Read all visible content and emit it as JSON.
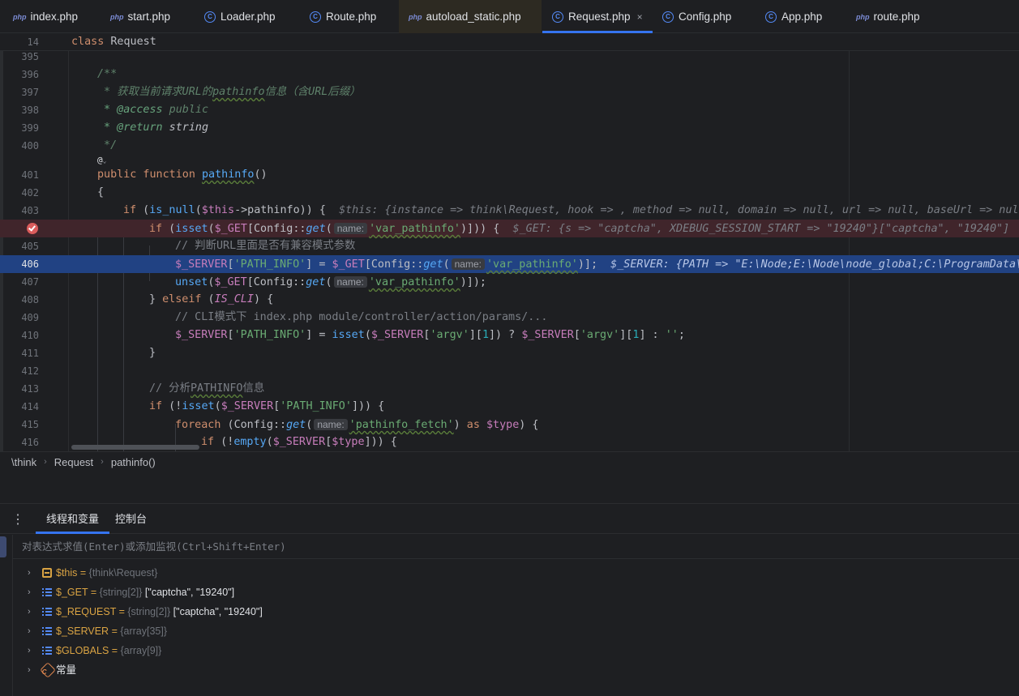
{
  "tabs": [
    {
      "label": "index.php",
      "icon": "php"
    },
    {
      "label": "start.php",
      "icon": "php"
    },
    {
      "label": "Loader.php",
      "icon": "class"
    },
    {
      "label": "Route.php",
      "icon": "class"
    },
    {
      "label": "autoload_static.php",
      "icon": "php"
    },
    {
      "label": "Request.php",
      "icon": "class"
    },
    {
      "label": "Config.php",
      "icon": "class"
    },
    {
      "label": "App.php",
      "icon": "class"
    },
    {
      "label": "route.php",
      "icon": "php"
    }
  ],
  "tab_close_glyph": "×",
  "icon_labels": {
    "php": "php",
    "class": "C"
  },
  "sticky": {
    "line": "14",
    "kw": "class",
    "name": "Request"
  },
  "lines": {
    "l395": "395",
    "l396": "396",
    "l397": "397",
    "l398": "398",
    "l399": "399",
    "l400": "400",
    "l401": "401",
    "l402": "402",
    "l403": "403",
    "l405": "405",
    "l406": "406",
    "l407": "407",
    "l408": "408",
    "l409": "409",
    "l410": "410",
    "l411": "411",
    "l412": "412",
    "l413": "413",
    "l414": "414",
    "l415": "415",
    "l416": "416"
  },
  "code": {
    "doc_open": "/**",
    "doc_desc_pre": " * 获取当前请求URL的",
    "doc_desc_word": "pathinfo",
    "doc_desc_post": "信息（含URL后缀）",
    "doc_access_tag": " * @access",
    "doc_access_val": " public",
    "doc_return_tag": " * @return",
    "doc_return_val": " string",
    "doc_close": " */",
    "annot_glyph": "@",
    "public": "public",
    "function": " function ",
    "fn_name": "pathinfo",
    "fn_parens": "()",
    "brace_open": "{",
    "brace_close": "}",
    "name_hint": "name:",
    "hint_key": "'var_pathinfo'",
    "if_kw": "if",
    "is_null": "is_null",
    "this_var": "$this",
    "arrow_prop": "->pathinfo)) {",
    "inline_this": "$this: {instance => think\\Request, hook => , method => null, domain => null, url => null, baseUrl => null",
    "isset": "isset",
    "get_var": "$_GET",
    "config": "Config",
    "get_fn": "get",
    "inline_get": "$_GET: {s => \"captcha\", XDEBUG_SESSION_START => \"19240\"}[\"captcha\", \"19240\"]",
    "cmt_405": "// 判断URL里面是否有兼容模式参数",
    "server_var": "$_SERVER",
    "path_info_key": "'PATH_INFO'",
    "inline_server": "$_SERVER: {PATH => \"E:\\Node;E:\\Node\\node_global;C:\\ProgramData\\",
    "unset": "unset",
    "elseif": "elseif",
    "is_cli": "IS_CLI",
    "cmt_409": "// CLI模式下 index.php module/controller/action/params/...",
    "argv_key": "'argv'",
    "one": "1",
    "empty_str": "''",
    "cmt_413_pre": "// 分析",
    "cmt_413_word": "PATHINFO",
    "cmt_413_post": "信息",
    "foreach": "foreach",
    "fetch_key": "'pathinfo_fetch'",
    "as": "as",
    "type_var": "$type",
    "empty": "empty"
  },
  "breadcrumb": [
    "\\think",
    "Request",
    "pathinfo()"
  ],
  "breadcrumb_sep": "›",
  "debug": {
    "menu_glyph": "⋮",
    "tabs": [
      "线程和变量",
      "控制台"
    ],
    "eval_placeholder": "对表达式求值(Enter)或添加监视(Ctrl+Shift+Enter)",
    "expand_glyph": "›",
    "variables": [
      {
        "name": "$this",
        "eq": " = ",
        "type": "{think\\Request}",
        "value": "",
        "icon": "object"
      },
      {
        "name": "$_GET",
        "eq": " = ",
        "type": "{string[2]}",
        "value": " [\"captcha\", \"19240\"]",
        "icon": "array"
      },
      {
        "name": "$_REQUEST",
        "eq": " = ",
        "type": "{string[2]}",
        "value": " [\"captcha\", \"19240\"]",
        "icon": "array"
      },
      {
        "name": "$_SERVER",
        "eq": " = ",
        "type": "{array[35]}",
        "value": "",
        "icon": "array"
      },
      {
        "name": "$GLOBALS",
        "eq": " = ",
        "type": "{array[9]}",
        "value": "",
        "icon": "array"
      },
      {
        "name": "常量",
        "eq": "",
        "type": "",
        "value": "",
        "icon": "constant"
      }
    ]
  },
  "colors": {
    "accent": "#3574f0",
    "breakpoint": "#db5c5c",
    "current_line": "#214283",
    "breakpoint_line": "#40252b"
  }
}
